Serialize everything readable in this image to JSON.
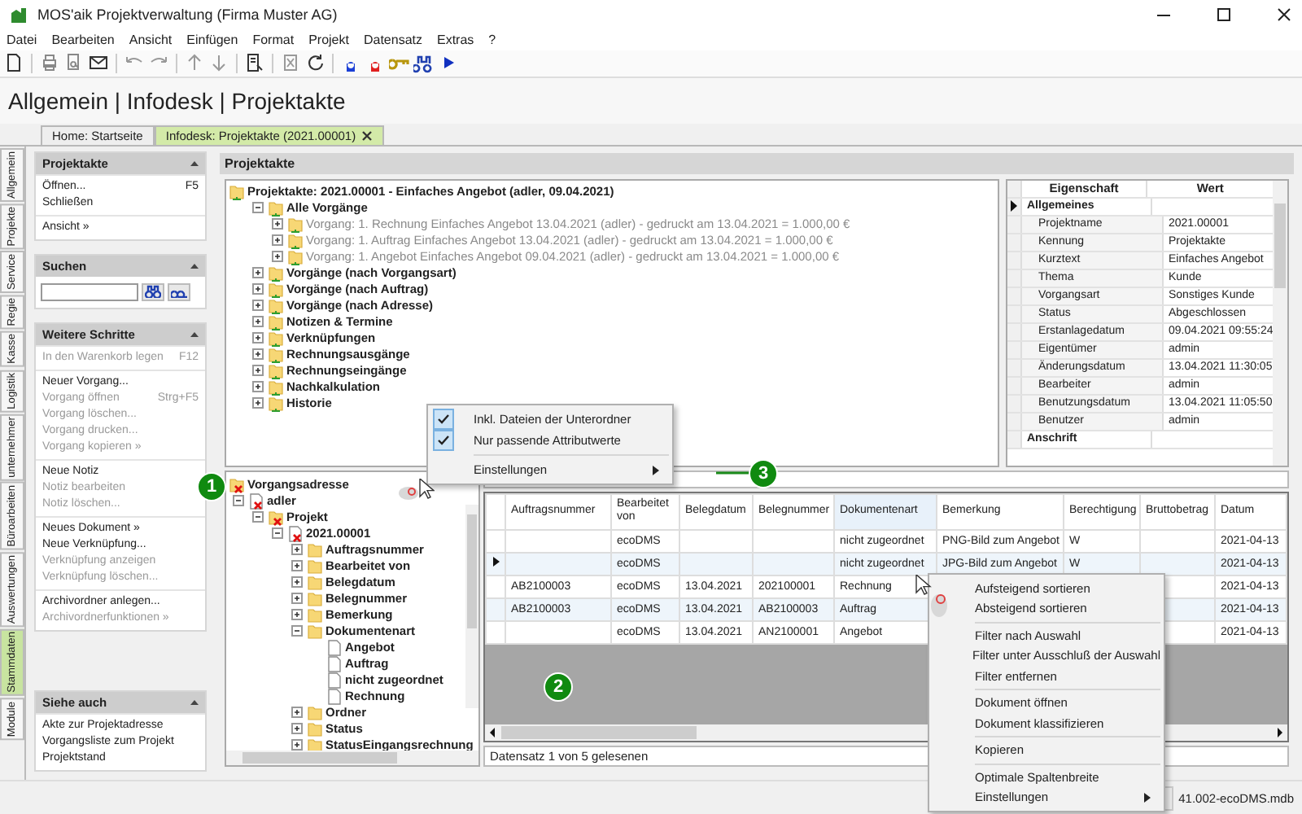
{
  "window": {
    "title": "MOS'aik Projektverwaltung (Firma Muster AG)"
  },
  "menu": [
    "Datei",
    "Bearbeiten",
    "Ansicht",
    "Einfügen",
    "Format",
    "Projekt",
    "Datensatz",
    "Extras",
    "?"
  ],
  "breadcrumb": "Allgemein | Infodesk | Projektakte",
  "tabs": [
    {
      "label": "Home: Startseite",
      "selected": false
    },
    {
      "label": "Infodesk: Projektakte (2021.00001)",
      "selected": true
    }
  ],
  "side_tabs": [
    {
      "label": "Allgemein",
      "selected": false
    },
    {
      "label": "Projekte",
      "selected": false
    },
    {
      "label": "Service",
      "selected": false
    },
    {
      "label": "Regie",
      "selected": false
    },
    {
      "label": "Kasse",
      "selected": false
    },
    {
      "label": "Logistik",
      "selected": false
    },
    {
      "label": "unternehmer",
      "selected": false
    },
    {
      "label": "Büroarbeiten",
      "selected": false
    },
    {
      "label": "Auswertungen",
      "selected": false
    },
    {
      "label": "Stammdaten",
      "selected": true
    },
    {
      "label": "Module",
      "selected": false
    }
  ],
  "sidebar": {
    "sections": [
      {
        "title": "Projektakte",
        "kind": "menu",
        "groups": [
          [
            {
              "label": "Öffnen...",
              "shortcut": "F5",
              "disabled": false
            },
            {
              "label": "Schließen",
              "disabled": false
            }
          ],
          [
            {
              "label": "Ansicht »",
              "disabled": false
            }
          ]
        ]
      },
      {
        "title": "Suchen",
        "kind": "search"
      },
      {
        "title": "Weitere Schritte",
        "kind": "menu",
        "groups": [
          [
            {
              "label": "In den Warenkorb legen",
              "shortcut": "F12",
              "disabled": true
            }
          ],
          [
            {
              "label": "Neuer Vorgang...",
              "disabled": false
            },
            {
              "label": "Vorgang öffnen",
              "shortcut": "Strg+F5",
              "disabled": true
            },
            {
              "label": "Vorgang löschen...",
              "disabled": true
            },
            {
              "label": "Vorgang drucken...",
              "disabled": true
            },
            {
              "label": "Vorgang kopieren »",
              "disabled": true
            }
          ],
          [
            {
              "label": "Neue Notiz",
              "disabled": false
            },
            {
              "label": "Notiz bearbeiten",
              "disabled": true
            },
            {
              "label": "Notiz löschen...",
              "disabled": true
            }
          ],
          [
            {
              "label": "Neues Dokument »",
              "disabled": false
            },
            {
              "label": "Neue Verknüpfung...",
              "disabled": false
            },
            {
              "label": "Verknüpfung anzeigen",
              "disabled": true
            },
            {
              "label": "Verknüpfung löschen...",
              "disabled": true
            }
          ],
          [
            {
              "label": "Archivordner anlegen...",
              "disabled": false
            },
            {
              "label": "Archivordnerfunktionen »",
              "disabled": true
            }
          ]
        ]
      },
      {
        "title": "Siehe auch",
        "kind": "menu",
        "groups": [
          [
            {
              "label": "Akte zur Projektadresse",
              "disabled": false
            },
            {
              "label": "Vorgangsliste zum Projekt",
              "disabled": false
            },
            {
              "label": "Projektstand",
              "disabled": false
            }
          ]
        ]
      }
    ]
  },
  "panel_title": "Projektakte",
  "project_tree": {
    "nodes": [
      {
        "label": "Projektakte: 2021.00001 - Einfaches Angebot (adler, 09.04.2021)",
        "greyed": false,
        "children": [
          {
            "label": "Alle Vorgänge",
            "greyed": false,
            "expanded": true,
            "children": [
              {
                "label": "Vorgang: 1. Rechnung Einfaches Angebot 13.04.2021 (adler) - gedruckt am 13.04.2021 = 1.000,00 €",
                "greyed": true,
                "expanded": false
              },
              {
                "label": "Vorgang: 1. Auftrag Einfaches Angebot 13.04.2021 (adler) - gedruckt am 13.04.2021 = 1.000,00 €",
                "greyed": true,
                "expanded": false
              },
              {
                "label": "Vorgang: 1. Angebot Einfaches Angebot 09.04.2021 (adler) - gedruckt am 13.04.2021 = 1.000,00 €",
                "greyed": true,
                "expanded": false
              }
            ]
          },
          {
            "label": "Vorgänge (nach Vorgangsart)",
            "greyed": false,
            "expanded": false
          },
          {
            "label": "Vorgänge (nach Auftrag)",
            "greyed": false,
            "expanded": false
          },
          {
            "label": "Vorgänge (nach Adresse)",
            "greyed": false,
            "expanded": false
          },
          {
            "label": "Notizen & Termine",
            "greyed": false,
            "expanded": false
          },
          {
            "label": "Verknüpfungen",
            "greyed": false,
            "expanded": false
          },
          {
            "label": "Rechnungsausgänge",
            "greyed": false,
            "expanded": false
          },
          {
            "label": "Rechnungseingänge",
            "greyed": false,
            "expanded": false
          },
          {
            "label": "Nachkalkulation",
            "greyed": false,
            "expanded": false
          },
          {
            "label": "Historie",
            "greyed": false,
            "expanded": false
          }
        ]
      }
    ]
  },
  "properties": {
    "columns": [
      "Eigenschaft",
      "Wert"
    ],
    "rows": [
      {
        "kind": "category",
        "label": "Allgemeines",
        "selected": true
      },
      {
        "kind": "property",
        "label": "Projektname",
        "value": "2021.00001",
        "selected": false
      },
      {
        "kind": "property",
        "label": "Kennung",
        "value": "Projektakte",
        "selected": false
      },
      {
        "kind": "property",
        "label": "Kurztext",
        "value": "Einfaches Angebot",
        "selected": false
      },
      {
        "kind": "property",
        "label": "Thema",
        "value": "Kunde",
        "selected": false
      },
      {
        "kind": "property",
        "label": "Vorgangsart",
        "value": "Sonstiges Kunde",
        "selected": false
      },
      {
        "kind": "property",
        "label": "Status",
        "value": "Abgeschlossen",
        "selected": false
      },
      {
        "kind": "property",
        "label": "Erstanlagedatum",
        "value": "09.04.2021 09:55:24",
        "selected": false
      },
      {
        "kind": "property",
        "label": "Eigentümer",
        "value": "admin",
        "selected": false
      },
      {
        "kind": "property",
        "label": "Änderungsdatum",
        "value": "13.04.2021 11:30:05",
        "selected": false
      },
      {
        "kind": "property",
        "label": "Bearbeiter",
        "value": "admin",
        "selected": false
      },
      {
        "kind": "property",
        "label": "Benutzungsdatum",
        "value": "13.04.2021 11:05:50",
        "selected": false
      },
      {
        "kind": "property",
        "label": "Benutzer",
        "value": "admin",
        "selected": false
      },
      {
        "kind": "category",
        "label": "Anschrift",
        "selected": false
      }
    ]
  },
  "attribute_tree": {
    "nodes": [
      {
        "label": "Vorgangsadresse",
        "kind": "invalid-group"
      },
      {
        "label": "adler",
        "kind": "invalid-record",
        "expanded": true,
        "children": [
          {
            "label": "Projekt",
            "kind": "invalid-group",
            "expanded": true,
            "children": [
              {
                "label": "2021.00001",
                "kind": "invalid-record",
                "expanded": true,
                "children": [
                  {
                    "label": "Auftragsnummer",
                    "kind": "group",
                    "expanded": false
                  },
                  {
                    "label": "Bearbeitet von",
                    "kind": "group",
                    "expanded": false
                  },
                  {
                    "label": "Belegdatum",
                    "kind": "group",
                    "expanded": false
                  },
                  {
                    "label": "Belegnummer",
                    "kind": "group",
                    "expanded": false
                  },
                  {
                    "label": "Bemerkung",
                    "kind": "group",
                    "expanded": false
                  },
                  {
                    "label": "Dokumentenart",
                    "kind": "group",
                    "expanded": true,
                    "children": [
                      {
                        "label": "Angebot",
                        "kind": "record"
                      },
                      {
                        "label": "Auftrag",
                        "kind": "record"
                      },
                      {
                        "label": "nicht zugeordnet",
                        "kind": "record"
                      },
                      {
                        "label": "Rechnung",
                        "kind": "record"
                      }
                    ]
                  },
                  {
                    "label": "Ordner",
                    "kind": "group",
                    "expanded": false
                  },
                  {
                    "label": "Status",
                    "kind": "group",
                    "expanded": false
                  },
                  {
                    "label": "StatusEingangsrechnung",
                    "kind": "group",
                    "expanded": false
                  }
                ]
              }
            ]
          }
        ]
      }
    ]
  },
  "documents": {
    "columns": [
      {
        "label": "Auftragsnummer",
        "selected": false
      },
      {
        "label": "Bearbeitet von",
        "selected": false
      },
      {
        "label": "Belegdatum",
        "selected": false
      },
      {
        "label": "Belegnummer",
        "selected": false
      },
      {
        "label": "Dokumentenart",
        "selected": true
      },
      {
        "label": "Bemerkung",
        "selected": false
      },
      {
        "label": "Berechtigung",
        "selected": false
      },
      {
        "label": "Bruttobetrag",
        "selected": false
      },
      {
        "label": "Datum",
        "selected": false
      }
    ],
    "rows": [
      {
        "selected": false,
        "cells": [
          null,
          "ecoDMS",
          null,
          null,
          "nicht zugeordnet",
          "PNG-Bild zum Angebot",
          "W",
          null,
          "2021-04-13"
        ]
      },
      {
        "selected": true,
        "cells": [
          null,
          "ecoDMS",
          null,
          null,
          "nicht zugeordnet",
          "JPG-Bild zum Angebot",
          "W",
          null,
          "2021-04-13"
        ]
      },
      {
        "selected": false,
        "cells": [
          "AB2100003",
          "ecoDMS",
          "13.04.2021",
          "202100001",
          "Rechnung",
          null,
          null,
          null,
          "2021-04-13"
        ]
      },
      {
        "selected": false,
        "cells": [
          "AB2100003",
          "ecoDMS",
          "13.04.2021",
          "AB2100003",
          "Auftrag",
          null,
          null,
          null,
          "2021-04-13"
        ]
      },
      {
        "selected": false,
        "cells": [
          null,
          "ecoDMS",
          "13.04.2021",
          "AN2100001",
          "Angebot",
          null,
          null,
          null,
          "2021-04-13"
        ]
      }
    ],
    "status": "Datensatz 1 von 5 gelesenen"
  },
  "tree_menu": {
    "groups": [
      [
        {
          "kind": "check",
          "label": "Inkl. Dateien der Unterordner",
          "checked": true
        },
        {
          "kind": "check",
          "label": "Nur passende Attributwerte",
          "checked": true
        }
      ],
      [
        {
          "kind": "submenu",
          "label": "Einstellungen"
        }
      ]
    ]
  },
  "grid_menu": {
    "groups": [
      [
        {
          "kind": "command",
          "label": "Aufsteigend sortieren"
        },
        {
          "kind": "command",
          "label": "Absteigend sortieren"
        }
      ],
      [
        {
          "kind": "command",
          "label": "Filter nach Auswahl"
        },
        {
          "kind": "command",
          "label": "Filter unter Ausschluß der Auswahl"
        },
        {
          "kind": "command",
          "label": "Filter entfernen"
        }
      ],
      [
        {
          "kind": "command",
          "label": "Dokument öffnen"
        },
        {
          "kind": "command",
          "label": "Dokument klassifizieren"
        }
      ],
      [
        {
          "kind": "command",
          "label": "Kopieren"
        }
      ],
      [
        {
          "kind": "command",
          "label": "Optimale Spaltenbreite"
        },
        {
          "kind": "submenu",
          "label": "Einstellungen"
        }
      ]
    ]
  },
  "callouts": [
    {
      "label": "1"
    },
    {
      "label": "2"
    },
    {
      "label": "3"
    }
  ],
  "status_bar": {
    "database": "41.002-ecoDMS.mdb"
  }
}
